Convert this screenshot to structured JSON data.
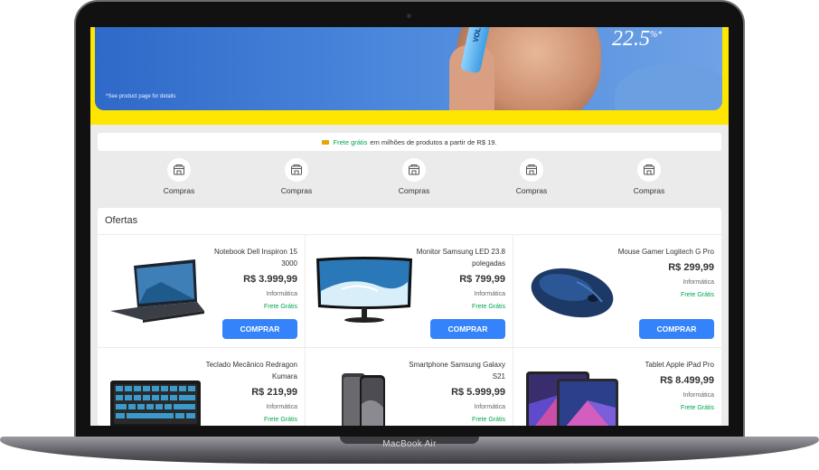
{
  "device": {
    "label": "MacBook Air"
  },
  "hero": {
    "note": "*See product page for details",
    "number": "22.5",
    "number_sup": "%*",
    "bottle_text": "VOL"
  },
  "shipping": {
    "highlight": "Frete grátis",
    "text": "em milhões de produtos a partir de R$ 19."
  },
  "categories": [
    {
      "label": "Compras",
      "icon": "shop-icon"
    },
    {
      "label": "Compras",
      "icon": "shop-icon"
    },
    {
      "label": "Compras",
      "icon": "shop-icon"
    },
    {
      "label": "Compras",
      "icon": "shop-icon"
    },
    {
      "label": "Compras",
      "icon": "shop-icon"
    }
  ],
  "offers": {
    "title": "Ofertas",
    "buy_label": "COMPRAR",
    "products": [
      {
        "name": "Notebook Dell Inspiron 15 3000",
        "price": "R$ 3.999,99",
        "category": "Informática",
        "shipping": "Frete Grátis",
        "image": "laptop"
      },
      {
        "name": "Monitor Samsung LED 23.8 polegadas",
        "price": "R$ 799,99",
        "category": "Informática",
        "shipping": "Frete Grátis",
        "image": "monitor"
      },
      {
        "name": "Mouse Gamer Logitech G Pro",
        "price": "R$ 299,99",
        "category": "Informática",
        "shipping": "Frete Grátis",
        "image": "mouse"
      },
      {
        "name": "Teclado Mecânico Redragon Kumara",
        "price": "R$ 219,99",
        "category": "Informática",
        "shipping": "Frete Grátis",
        "image": "keyboard"
      },
      {
        "name": "Smartphone Samsung Galaxy S21",
        "price": "R$ 5.999,99",
        "category": "Informática",
        "shipping": "Frete Grátis",
        "image": "phone"
      },
      {
        "name": "Tablet Apple iPad Pro",
        "price": "R$ 8.499,99",
        "category": "Informática",
        "shipping": "Frete Grátis",
        "image": "tablet"
      }
    ]
  },
  "colors": {
    "accent": "#3483fa",
    "brand_yellow": "#ffe600",
    "free_shipping": "#00a650"
  }
}
